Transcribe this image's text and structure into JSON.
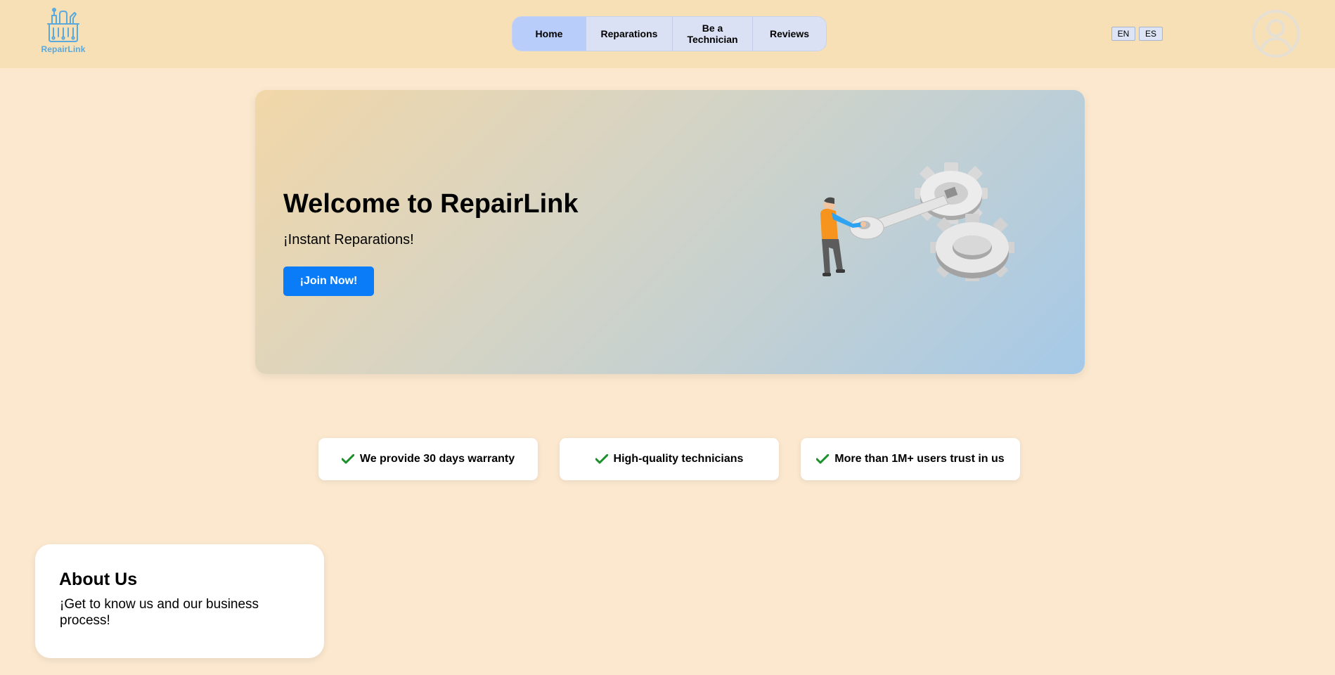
{
  "brand": {
    "logo_text": "RepairLink",
    "accent": "#5aa9dd"
  },
  "nav": {
    "items": [
      {
        "label": "Home",
        "active": true
      },
      {
        "label": "Reparations",
        "active": false
      },
      {
        "label": "Be a Technician",
        "active": false
      },
      {
        "label": "Reviews",
        "active": false
      }
    ]
  },
  "language": {
    "options": [
      "EN",
      "ES"
    ]
  },
  "user": {
    "avatar_icon": "user-circle-icon"
  },
  "hero": {
    "title": "Welcome to RepairLink",
    "subtitle": "¡Instant Reparations!",
    "cta_label": "¡Join Now!",
    "cta_color": "#0b7cf7",
    "illustration": "technician-with-wrench-and-gears"
  },
  "features": [
    {
      "icon": "check-icon",
      "text": "We provide 30 days warranty"
    },
    {
      "icon": "check-icon",
      "text": "High-quality technicians"
    },
    {
      "icon": "check-icon",
      "text": "More than 1M+ users trust in us"
    }
  ],
  "about": {
    "title": "About Us",
    "text": "¡Get to know us and our business process!"
  },
  "colors": {
    "page_bg": "#fbe8cf",
    "header_bg": "#f7e0b6",
    "nav_active": "#b8cdfa",
    "check_green": "#1a8f2a"
  }
}
